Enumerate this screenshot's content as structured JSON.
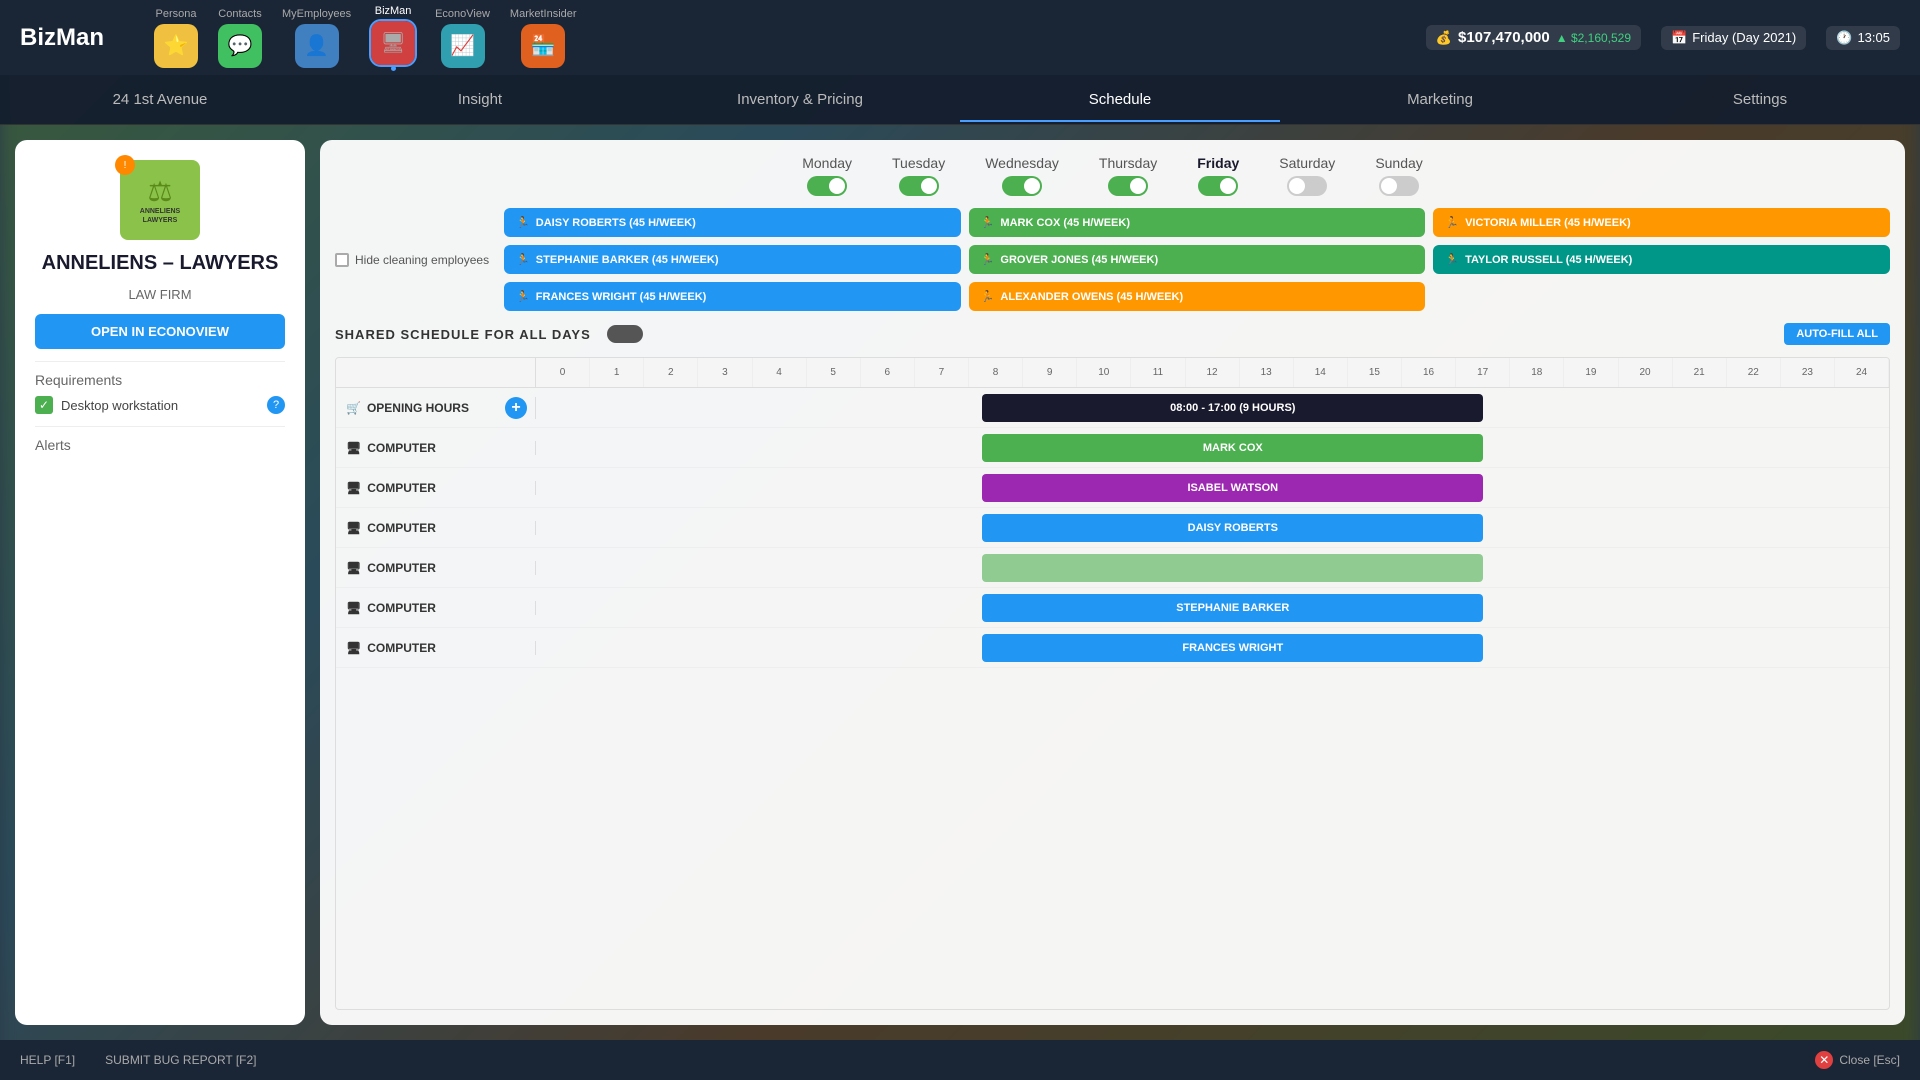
{
  "app": {
    "name": "BizMan"
  },
  "topbar": {
    "nav_items": [
      {
        "label": "Persona",
        "icon": "⭐",
        "color": "yellow",
        "active": false
      },
      {
        "label": "Contacts",
        "icon": "💬",
        "color": "green",
        "active": false
      },
      {
        "label": "MyEmployees",
        "icon": "👤",
        "color": "blue",
        "active": false
      },
      {
        "label": "BizMan",
        "icon": "🖥",
        "color": "red",
        "active": true
      },
      {
        "label": "EconoView",
        "icon": "📈",
        "color": "teal",
        "active": false
      },
      {
        "label": "MarketInsider",
        "icon": "🏪",
        "color": "orange",
        "active": false
      }
    ],
    "money_icon": "💰",
    "money_amount": "$107,470,000",
    "money_change": "▲ $2,160,529",
    "calendar_icon": "📅",
    "date": "Friday (Day 2021)",
    "clock_icon": "🕐",
    "time": "13:05"
  },
  "subnav": {
    "items": [
      {
        "label": "24 1st Avenue",
        "active": false
      },
      {
        "label": "Insight",
        "active": false
      },
      {
        "label": "Inventory & Pricing",
        "active": false
      },
      {
        "label": "Schedule",
        "active": true
      },
      {
        "label": "Marketing",
        "active": false
      },
      {
        "label": "Settings",
        "active": false
      }
    ]
  },
  "left_panel": {
    "business_logo_icon": "⚖",
    "business_name": "ANNELIENS – LAWYERS",
    "business_type": "LAW FIRM",
    "open_btn_label": "OPEN IN ECONOVIEW",
    "requirements_label": "Requirements",
    "requirements": [
      {
        "label": "Desktop workstation",
        "checked": true
      }
    ],
    "alerts_label": "Alerts",
    "notification_count": "!"
  },
  "schedule": {
    "days": [
      {
        "label": "Monday",
        "on": true,
        "active": false
      },
      {
        "label": "Tuesday",
        "on": true,
        "active": false
      },
      {
        "label": "Wednesday",
        "on": true,
        "active": false
      },
      {
        "label": "Thursday",
        "on": true,
        "active": false
      },
      {
        "label": "Friday",
        "on": true,
        "active": true
      },
      {
        "label": "Saturday",
        "on": false,
        "active": false
      },
      {
        "label": "Sunday",
        "on": false,
        "active": false
      }
    ],
    "hide_cleaning_label": "Hide cleaning employees",
    "employees": [
      {
        "label": "DAISY ROBERTS (45 H/WEEK)",
        "color": "blue"
      },
      {
        "label": "MARK COX (45 H/WEEK)",
        "color": "green"
      },
      {
        "label": "VICTORIA MILLER (45 H/WEEK)",
        "color": "orange"
      },
      {
        "label": "STEPHANIE BARKER (45 H/WEEK)",
        "color": "blue"
      },
      {
        "label": "GROVER JONES (45 H/WEEK)",
        "color": "green"
      },
      {
        "label": "TAYLOR RUSSELL (45 H/WEEK)",
        "color": "teal"
      },
      {
        "label": "FRANCES WRIGHT (45 H/WEEK)",
        "color": "blue"
      },
      {
        "label": "ALEXANDER OWENS (45 H/WEEK)",
        "color": "orange"
      }
    ],
    "shared_schedule_label": "SHARED SCHEDULE FOR ALL DAYS",
    "auto_fill_label": "AUTO-FILL ALL",
    "hours": [
      0,
      1,
      2,
      3,
      4,
      5,
      6,
      7,
      8,
      9,
      10,
      11,
      12,
      13,
      14,
      15,
      16,
      17,
      18,
      19,
      20,
      21,
      22,
      23,
      24
    ],
    "rows": [
      {
        "label": "OPENING HOURS",
        "type": "opening",
        "icon": "🛒",
        "bar": {
          "text": "08:00 - 17:00 (9 HOURS)",
          "color": "opening",
          "start_pct": 33,
          "width_pct": 37
        }
      },
      {
        "label": "COMPUTER",
        "type": "computer",
        "icon": "🖥",
        "bar": {
          "text": "MARK COX",
          "color": "green",
          "start_pct": 33,
          "width_pct": 37
        }
      },
      {
        "label": "COMPUTER",
        "type": "computer",
        "icon": "🖥",
        "bar": {
          "text": "ISABEL WATSON",
          "color": "purple",
          "start_pct": 33,
          "width_pct": 37
        }
      },
      {
        "label": "COMPUTER",
        "type": "computer",
        "icon": "🖥",
        "bar": {
          "text": "DAISY ROBERTS",
          "color": "blue",
          "start_pct": 33,
          "width_pct": 37
        }
      },
      {
        "label": "COMPUTER",
        "type": "computer",
        "icon": "🖥",
        "bar": {
          "text": "",
          "color": "green",
          "start_pct": 33,
          "width_pct": 37
        }
      },
      {
        "label": "COMPUTER",
        "type": "computer",
        "icon": "🖥",
        "bar": {
          "text": "STEPHANIE BARKER",
          "color": "blue",
          "start_pct": 33,
          "width_pct": 37
        }
      },
      {
        "label": "COMPUTER",
        "type": "computer",
        "icon": "🖥",
        "bar": {
          "text": "FRANCES WRIGHT",
          "color": "blue",
          "start_pct": 33,
          "width_pct": 37
        }
      }
    ]
  },
  "bottombar": {
    "help_label": "HELP [F1]",
    "bug_label": "SUBMIT BUG REPORT [F2]",
    "close_label": "Close [Esc]"
  }
}
